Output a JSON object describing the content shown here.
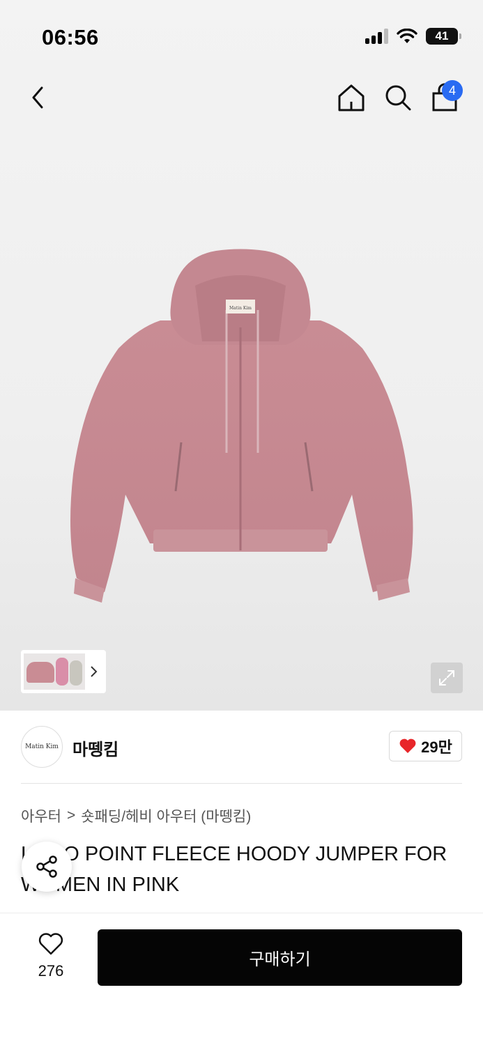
{
  "status_bar": {
    "time": "06:56",
    "battery": "41"
  },
  "header": {
    "cart_count": "4"
  },
  "product_image": {
    "label_text": "Matin Kim"
  },
  "brand": {
    "logo_text": "Matin Kim",
    "name": "마뗑킴",
    "likes": "29만"
  },
  "breadcrumb": {
    "level1": "아우터",
    "separator": ">",
    "level2": "숏패딩/헤비 아우터 (마뗑킴)"
  },
  "product": {
    "title": "LOGO POINT FLEECE HOODY JUMPER FOR WOMEN IN PINK"
  },
  "bottom": {
    "wish_count": "276",
    "buy_label": "구매하기"
  },
  "colors": {
    "accent_blue": "#2a6bf2",
    "heart_red": "#e8262a",
    "jacket_pink": "#c98c94",
    "buy_black": "#050505"
  },
  "icons": [
    "back-arrow-icon",
    "home-icon",
    "search-icon",
    "shopping-bag-icon",
    "chevron-right-icon",
    "expand-icon",
    "heart-filled-icon",
    "share-icon",
    "heart-outline-icon"
  ]
}
